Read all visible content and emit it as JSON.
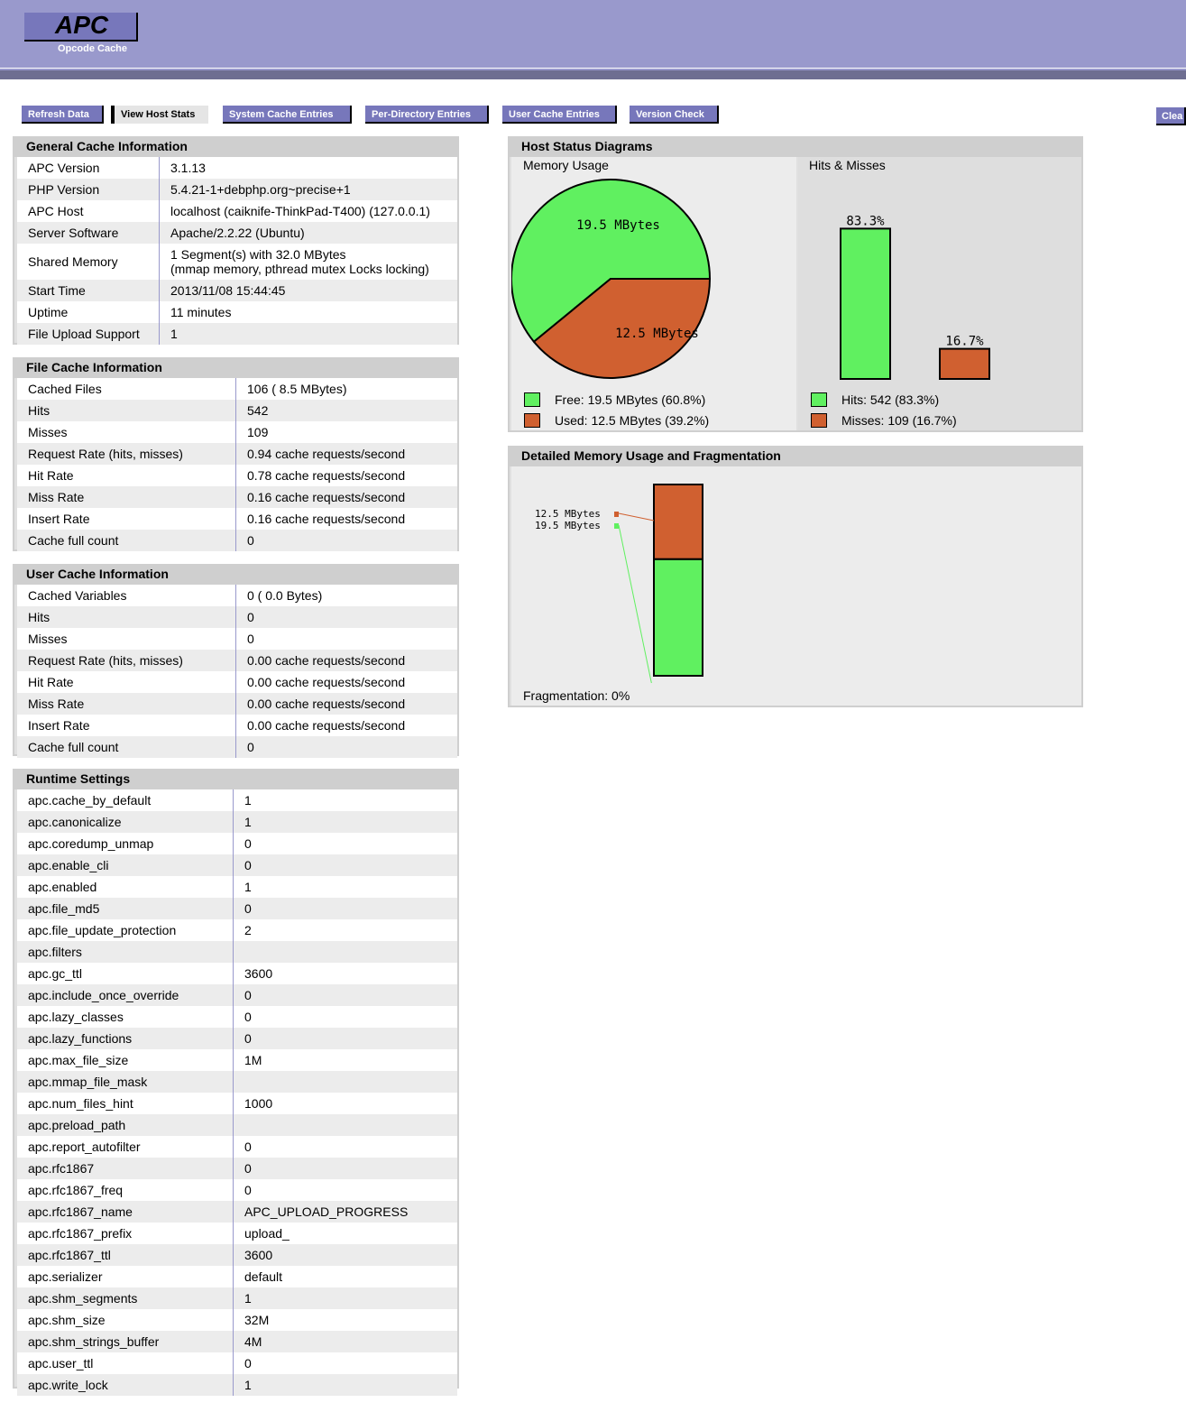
{
  "header": {
    "title": "APC",
    "subtitle": "Opcode Cache"
  },
  "nav": {
    "refresh": "Refresh Data",
    "host_stats": "View Host Stats",
    "system_cache": "System Cache Entries",
    "per_directory": "Per-Directory Entries",
    "user_cache": "User Cache Entries",
    "version_check": "Version Check",
    "clear": "Clea"
  },
  "general": {
    "title": "General Cache Information",
    "rows": [
      {
        "k": "APC Version",
        "v": "3.1.13"
      },
      {
        "k": "PHP Version",
        "v": "5.4.21-1+debphp.org~precise+1"
      },
      {
        "k": "APC Host",
        "v": "localhost (caiknife-ThinkPad-T400) (127.0.0.1)"
      },
      {
        "k": "Server Software",
        "v": "Apache/2.2.22 (Ubuntu)"
      },
      {
        "k": "Shared Memory",
        "v": "1 Segment(s) with 32.0 MBytes",
        "v2": "(mmap memory, pthread mutex Locks locking)"
      },
      {
        "k": "Start Time",
        "v": "2013/11/08 15:44:45"
      },
      {
        "k": "Uptime",
        "v": "11 minutes"
      },
      {
        "k": "File Upload Support",
        "v": "1"
      }
    ]
  },
  "file_cache": {
    "title": "File Cache Information",
    "rows": [
      {
        "k": "Cached Files",
        "v": "106 ( 8.5 MBytes)"
      },
      {
        "k": "Hits",
        "v": "542"
      },
      {
        "k": "Misses",
        "v": "109"
      },
      {
        "k": "Request Rate (hits, misses)",
        "v": "0.94 cache requests/second"
      },
      {
        "k": "Hit Rate",
        "v": "0.78 cache requests/second"
      },
      {
        "k": "Miss Rate",
        "v": "0.16 cache requests/second"
      },
      {
        "k": "Insert Rate",
        "v": "0.16 cache requests/second"
      },
      {
        "k": "Cache full count",
        "v": "0"
      }
    ]
  },
  "user_cache": {
    "title": "User Cache Information",
    "rows": [
      {
        "k": "Cached Variables",
        "v": "0 ( 0.0 Bytes)"
      },
      {
        "k": "Hits",
        "v": "0"
      },
      {
        "k": "Misses",
        "v": "0"
      },
      {
        "k": "Request Rate (hits, misses)",
        "v": "0.00 cache requests/second"
      },
      {
        "k": "Hit Rate",
        "v": "0.00 cache requests/second"
      },
      {
        "k": "Miss Rate",
        "v": "0.00 cache requests/second"
      },
      {
        "k": "Insert Rate",
        "v": "0.00 cache requests/second"
      },
      {
        "k": "Cache full count",
        "v": "0"
      }
    ]
  },
  "runtime": {
    "title": "Runtime Settings",
    "rows": [
      {
        "k": "apc.cache_by_default",
        "v": "1"
      },
      {
        "k": "apc.canonicalize",
        "v": "1"
      },
      {
        "k": "apc.coredump_unmap",
        "v": "0"
      },
      {
        "k": "apc.enable_cli",
        "v": "0"
      },
      {
        "k": "apc.enabled",
        "v": "1"
      },
      {
        "k": "apc.file_md5",
        "v": "0"
      },
      {
        "k": "apc.file_update_protection",
        "v": "2"
      },
      {
        "k": "apc.filters",
        "v": ""
      },
      {
        "k": "apc.gc_ttl",
        "v": "3600"
      },
      {
        "k": "apc.include_once_override",
        "v": "0"
      },
      {
        "k": "apc.lazy_classes",
        "v": "0"
      },
      {
        "k": "apc.lazy_functions",
        "v": "0"
      },
      {
        "k": "apc.max_file_size",
        "v": "1M"
      },
      {
        "k": "apc.mmap_file_mask",
        "v": ""
      },
      {
        "k": "apc.num_files_hint",
        "v": "1000"
      },
      {
        "k": "apc.preload_path",
        "v": ""
      },
      {
        "k": "apc.report_autofilter",
        "v": "0"
      },
      {
        "k": "apc.rfc1867",
        "v": "0"
      },
      {
        "k": "apc.rfc1867_freq",
        "v": "0"
      },
      {
        "k": "apc.rfc1867_name",
        "v": "APC_UPLOAD_PROGRESS"
      },
      {
        "k": "apc.rfc1867_prefix",
        "v": "upload_"
      },
      {
        "k": "apc.rfc1867_ttl",
        "v": "3600"
      },
      {
        "k": "apc.serializer",
        "v": "default"
      },
      {
        "k": "apc.shm_segments",
        "v": "1"
      },
      {
        "k": "apc.shm_size",
        "v": "32M"
      },
      {
        "k": "apc.shm_strings_buffer",
        "v": "4M"
      },
      {
        "k": "apc.user_ttl",
        "v": "0"
      },
      {
        "k": "apc.write_lock",
        "v": "1"
      }
    ]
  },
  "host_status": {
    "title": "Host Status Diagrams",
    "memory_title": "Memory Usage",
    "hits_title": "Hits & Misses",
    "free_legend": "Free: 19.5 MBytes (60.8%)",
    "used_legend": "Used: 12.5 MBytes (39.2%)",
    "hits_legend": "Hits: 542 (83.3%)",
    "misses_legend": "Misses: 109 (16.7%)"
  },
  "fragmentation": {
    "title": "Detailed Memory Usage and Fragmentation",
    "label": "Fragmentation: 0%"
  },
  "colors": {
    "free": "#60f060",
    "used": "#d06030",
    "accent": "#9999cc",
    "button": "#7777bb"
  },
  "chart_data": [
    {
      "type": "pie",
      "title": "Memory Usage",
      "categories": [
        "Free",
        "Used"
      ],
      "values": [
        19.5,
        12.5
      ],
      "labels": [
        "19.5 MBytes",
        "12.5 MBytes"
      ],
      "colors": [
        "#60f060",
        "#d06030"
      ]
    },
    {
      "type": "bar",
      "title": "Hits & Misses",
      "categories": [
        "Hits",
        "Misses"
      ],
      "values": [
        83.3,
        16.7
      ],
      "labels": [
        "83.3%",
        "16.7%"
      ],
      "colors": [
        "#60f060",
        "#d06030"
      ]
    },
    {
      "type": "bar",
      "title": "Detailed Memory Usage and Fragmentation",
      "categories": [
        "Used",
        "Free"
      ],
      "values": [
        12.5,
        19.5
      ],
      "labels": [
        "12.5 MBytes",
        "19.5 MBytes"
      ],
      "colors": [
        "#d06030",
        "#60f060"
      ]
    }
  ]
}
